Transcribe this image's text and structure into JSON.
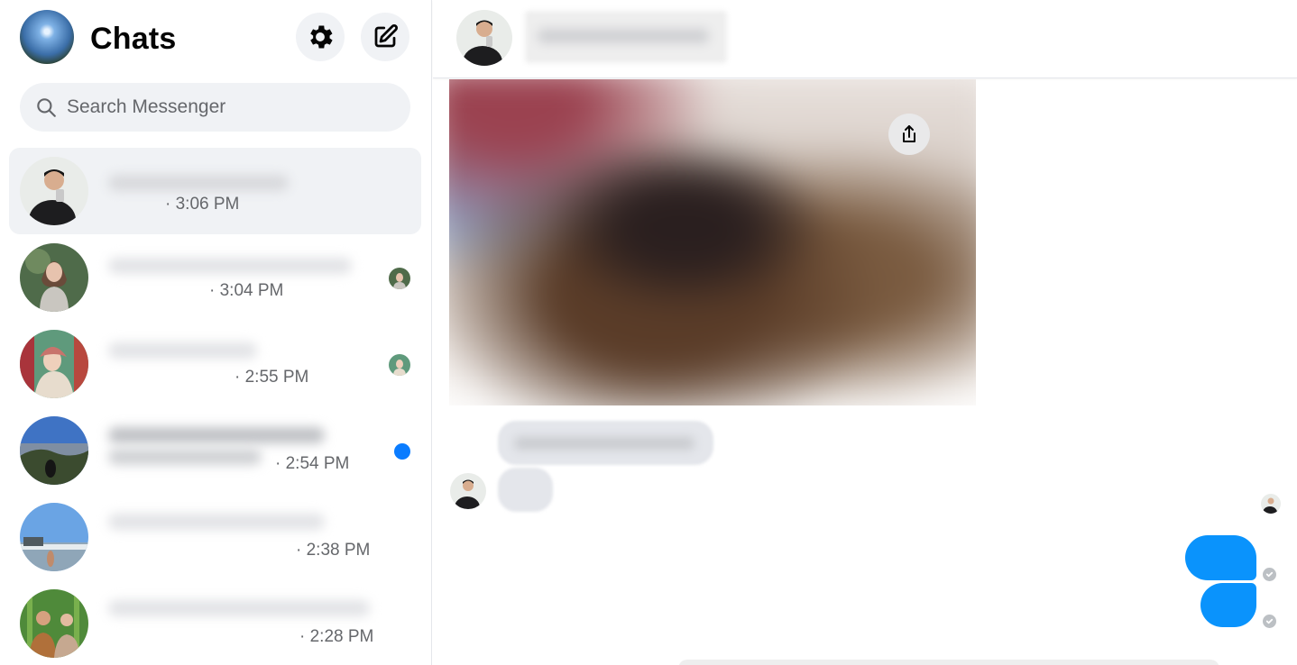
{
  "sidebar": {
    "title": "Chats",
    "search_placeholder": "Search Messenger",
    "chats": [
      {
        "time": "· 3:06 PM",
        "status": "none",
        "active": true
      },
      {
        "time": "· 3:04 PM",
        "status": "seen"
      },
      {
        "time": "· 2:55 PM",
        "status": "seen"
      },
      {
        "time": "· 2:54 PM",
        "status": "unread"
      },
      {
        "time": "· 2:38 PM",
        "status": "none"
      },
      {
        "time": "· 2:28 PM",
        "status": "none"
      }
    ]
  },
  "icons": {
    "settings": "gear-icon",
    "compose": "compose-icon",
    "search": "search-icon",
    "share": "share-icon",
    "sent": "check-circle-icon"
  },
  "colors": {
    "accent": "#0a7cff",
    "outgoing_bubble": "#0a93fc",
    "incoming_bubble": "#e4e6eb",
    "panel_bg": "#f0f2f5"
  }
}
